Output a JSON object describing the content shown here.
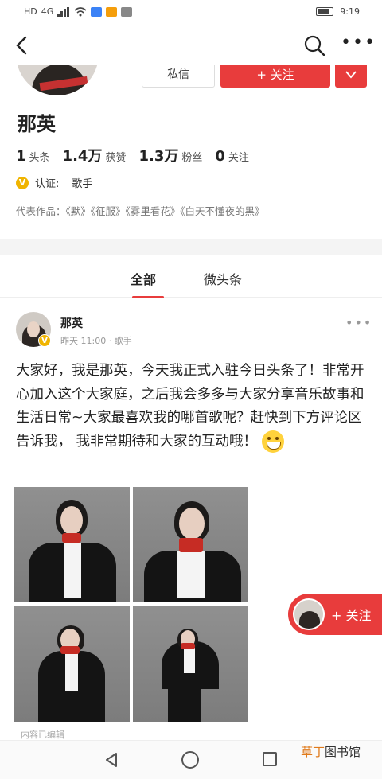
{
  "status_bar": {
    "carrier": "HD",
    "signal": "4G",
    "time": "9:19"
  },
  "header": {
    "message_label": "私信",
    "follow_label": "+ 关注"
  },
  "profile": {
    "name": "那英",
    "stats": [
      {
        "value": "1",
        "label": "头条"
      },
      {
        "value": "1.4万",
        "label": "获赞"
      },
      {
        "value": "1.3万",
        "label": "粉丝"
      },
      {
        "value": "0",
        "label": "关注"
      }
    ],
    "verification_label": "认证:",
    "verification_value": "歌手",
    "representative_works": "代表作品：《默》《征服》《雾里看花》《白天不懂夜的黑》"
  },
  "tabs": [
    {
      "label": "全部",
      "active": true
    },
    {
      "label": "微头条",
      "active": false
    }
  ],
  "post": {
    "author": "那英",
    "meta": "昨天 11:00 · 歌手",
    "text": "大家好，我是那英，今天我正式入驻今日头条了！非常开心加入这个大家庭，之后我会多多与大家分享音乐故事和生活日常~大家最喜欢我的哪首歌呢？赶快到下方评论区告诉我， 我非常期待和大家的互动哦！",
    "photo_count": 4,
    "edited_note": "内容已编辑"
  },
  "floating_follow": {
    "label": "+ 关注"
  },
  "watermark": {
    "highlight": "草丁",
    "rest": "图书馆"
  },
  "colors": {
    "accent": "#e83c3c",
    "verify_badge": "#f0b400",
    "watermark_highlight": "#e07a1a"
  },
  "icons": [
    "back-arrow-icon",
    "search-icon",
    "more-icon",
    "chevron-down-icon",
    "verified-badge-icon",
    "grinning-emoji-icon",
    "nav-back-icon",
    "nav-home-icon",
    "nav-recent-icon"
  ]
}
